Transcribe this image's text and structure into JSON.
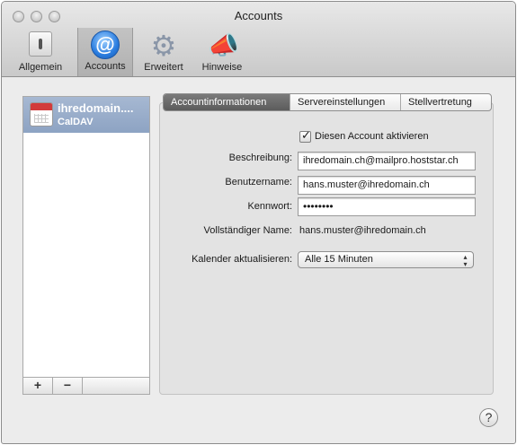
{
  "window": {
    "title": "Accounts"
  },
  "toolbar": {
    "items": [
      {
        "label": "Allgemein",
        "icon": "switch-icon"
      },
      {
        "label": "Accounts",
        "icon": "at-sign-icon",
        "selected": true
      },
      {
        "label": "Erweitert",
        "icon": "gear-icon"
      },
      {
        "label": "Hinweise",
        "icon": "megaphone-icon"
      }
    ]
  },
  "sidebar": {
    "accounts": [
      {
        "name": "ihredomain....",
        "type": "CalDAV",
        "icon": "calendar-icon",
        "selected": true
      }
    ],
    "add_label": "+",
    "remove_label": "−"
  },
  "tabs": [
    {
      "label": "Accountinformationen",
      "active": true
    },
    {
      "label": "Servereinstellungen",
      "active": false
    },
    {
      "label": "Stellvertretung",
      "active": false
    }
  ],
  "form": {
    "enable_label": "Diesen Account aktivieren",
    "enable_checked": true,
    "description_label": "Beschreibung:",
    "description_value": "ihredomain.ch@mailpro.hoststar.ch",
    "username_label": "Benutzername:",
    "username_value": "hans.muster@ihredomain.ch",
    "password_label": "Kennwort:",
    "password_value": "••••••••",
    "fullname_label": "Vollständiger Name:",
    "fullname_value": "hans.muster@ihredomain.ch",
    "refresh_label": "Kalender aktualisieren:",
    "refresh_value": "Alle 15 Minuten"
  },
  "help": {
    "label": "?"
  },
  "colors": {
    "selection": "#95aacb",
    "active_tab": "#6a6a6a",
    "accent_blue": "#2a7de0"
  }
}
